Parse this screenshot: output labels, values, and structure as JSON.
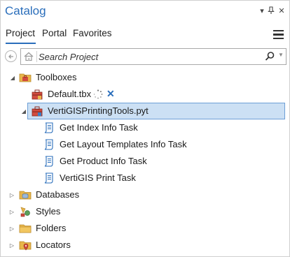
{
  "pane": {
    "title": "Catalog",
    "pin_glyph": "▾",
    "close_glyph": "✕"
  },
  "tabs": [
    {
      "label": "Project",
      "active": true
    },
    {
      "label": "Portal",
      "active": false
    },
    {
      "label": "Favorites",
      "active": false
    }
  ],
  "search": {
    "placeholder": "Search Project",
    "value": ""
  },
  "tree": {
    "toolboxes": "Toolboxes",
    "default_tbx": "Default.tbx",
    "pyt": "VertiGISPrintingTools.pyt",
    "tasks": [
      "Get Index Info Task",
      "Get Layout Templates Info Task",
      "Get Product Info Task",
      "VertiGIS Print Task"
    ],
    "databases": "Databases",
    "styles": "Styles",
    "folders": "Folders",
    "locators": "Locators"
  },
  "colors": {
    "accent": "#2a6ebb",
    "selection_fill": "#cce0f4",
    "selection_border": "#6d9fd6",
    "folder": "#e8b64a"
  }
}
